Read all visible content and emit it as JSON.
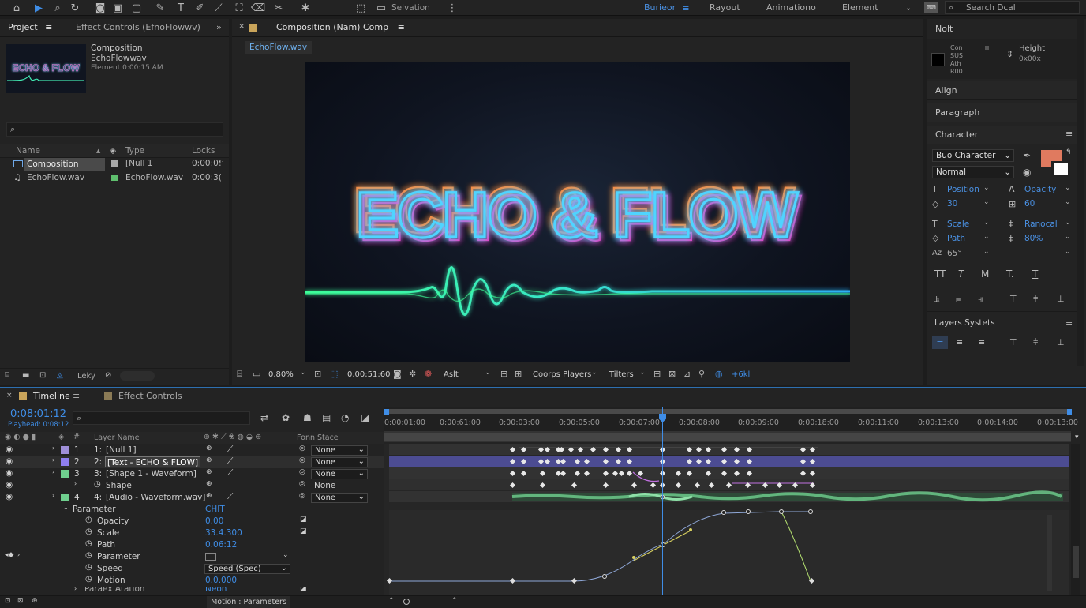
{
  "toolbar": {
    "selection_label": "Selvation",
    "workspaces": [
      "Burieor",
      "Rayout",
      "Animationo",
      "Element"
    ],
    "search_placeholder": "Search Dcal",
    "active_workspace_color": "#4a90e2"
  },
  "project": {
    "tab_label": "Project",
    "effect_controls_tab": "Effect Controls (EfnoFlowwv)",
    "item_title": "Composition",
    "item_subtitle": "EchoFlowwav",
    "item_meta": "Element 0:00:15 AM",
    "thumb_text": "ECHO & FLOW",
    "search_placeholder": "",
    "columns": [
      "Name",
      "Type",
      "Locks"
    ],
    "rows": [
      {
        "name": "Composition",
        "type": "[Null 1",
        "locks": "0:00:0!",
        "swatch": "#aaaaaa",
        "icon": "composition-icon"
      },
      {
        "name": "EchoFlow.wav",
        "type": "EchoFlow.wav",
        "locks": "0:00:3(",
        "swatch": "#5fbf6e",
        "icon": "audio-icon"
      }
    ],
    "footer_label": "Leky"
  },
  "viewer": {
    "tab_label": "Composition (Nam) Comp",
    "file_tab": "EchoFlow.wav",
    "neon_text_1": "ECHO & FLOW",
    "bottom": {
      "zoom": "0.80%",
      "timecode": "0.00:51:60",
      "resolution": "Aslt",
      "players": "Coorps Players",
      "filters": "Tilters",
      "exposure": "+6kl"
    }
  },
  "right_panel": {
    "header": "Nolt",
    "swatch_lines": [
      "Con",
      "SUS",
      "Ath",
      "R00"
    ],
    "height_label": "Height",
    "height_value": "0x00x",
    "align": "Align",
    "paragraph": "Paragraph",
    "character": "Character",
    "font_select": "Buo Character",
    "style_select": "Normal",
    "fill_color": "#e07a5f",
    "props": [
      {
        "label": "Position",
        "value": "30"
      },
      {
        "label": "Opacity",
        "value": "60"
      },
      {
        "label": "Scale",
        "value": "Ranocal"
      },
      {
        "label": "Path",
        "value": "80%"
      },
      {
        "label": "",
        "value": "65°"
      }
    ],
    "layers_section": "Layers Systets"
  },
  "timeline": {
    "tab_label": "Timeline",
    "effect_tab": "Effect Controls",
    "timecode": "0:08:01:12",
    "playhead": "Playhead: 0:08:12",
    "columns": {
      "layer_name": "Layer Name",
      "form_state": "Fonn Stace"
    },
    "ruler": [
      "0:00:01:00",
      "0:00:61:00",
      "0:00:03:00",
      "0:00:05:00",
      "0:00:07:00",
      "0:00:08:00",
      "0:00:09:00",
      "0:00:18:00",
      "0:00:11:00",
      "0:00:13:00",
      "0:00:14:00",
      "0:00:13:00"
    ],
    "layers": [
      {
        "num": "1",
        "name": "[Null 1]",
        "color": "#9f8fd8",
        "mode": "None"
      },
      {
        "num": "2",
        "name": "[Text - ECHO & FLOW]",
        "color": "#8f7ef0",
        "mode": "None"
      },
      {
        "num": "3",
        "name": "[Shape 1 - Waveform]",
        "color": "#6fcf8e",
        "mode": "None"
      },
      {
        "num": "",
        "name": "Shape",
        "color": "",
        "mode": "None"
      },
      {
        "num": "4",
        "name": "[Audio - Waveform.wav]",
        "color": "#6fcf8e",
        "mode": "None"
      }
    ],
    "parameter_group": "Parameter",
    "parameter_unit": "CHIT",
    "params": [
      {
        "label": "Opacity",
        "value": "0.00"
      },
      {
        "label": "Scale",
        "value": "33.4.300"
      },
      {
        "label": "Path",
        "value": "0.06:12"
      },
      {
        "label": "Parameter",
        "value": ""
      },
      {
        "label": "Speed",
        "value": "Speed (Spec)"
      },
      {
        "label": "Motion",
        "value": "0.0.000"
      }
    ],
    "footer_cut": "Paraex Atation",
    "footer_cut_value": "Neon",
    "status": "Motion : Parameters"
  }
}
